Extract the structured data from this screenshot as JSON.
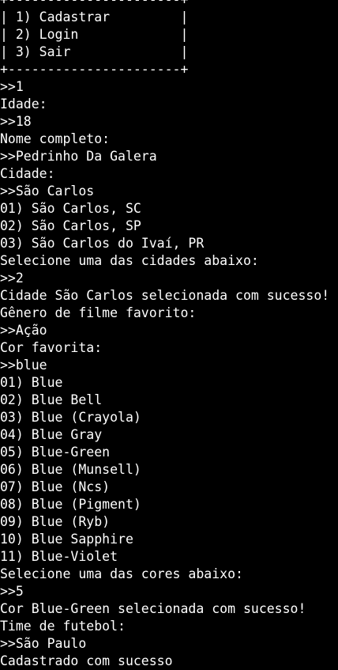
{
  "terminal": {
    "lines": [
      {
        "kind": "menu-border",
        "text": "+----------------------+"
      },
      {
        "kind": "menu-item",
        "text": "| 1) Cadastrar         |"
      },
      {
        "kind": "menu-item",
        "text": "| 2) Login             |"
      },
      {
        "kind": "menu-item",
        "text": "| 3) Sair              |"
      },
      {
        "kind": "menu-border",
        "text": "+----------------------+"
      },
      {
        "kind": "input",
        "text": ">>1"
      },
      {
        "kind": "prompt",
        "text": "Idade:"
      },
      {
        "kind": "input",
        "text": ">>18"
      },
      {
        "kind": "prompt",
        "text": "Nome completo:"
      },
      {
        "kind": "input",
        "text": ">>Pedrinho Da Galera"
      },
      {
        "kind": "prompt",
        "text": "Cidade:"
      },
      {
        "kind": "input",
        "text": ">>São Carlos"
      },
      {
        "kind": "option",
        "text": "01) São Carlos, SC"
      },
      {
        "kind": "option",
        "text": "02) São Carlos, SP"
      },
      {
        "kind": "option",
        "text": "03) São Carlos do Ivaí, PR"
      },
      {
        "kind": "prompt",
        "text": "Selecione uma das cidades abaixo:"
      },
      {
        "kind": "input",
        "text": ">>2"
      },
      {
        "kind": "message",
        "text": "Cidade São Carlos selecionada com sucesso!"
      },
      {
        "kind": "prompt",
        "text": "Gênero de filme favorito:"
      },
      {
        "kind": "input",
        "text": ">>Ação"
      },
      {
        "kind": "prompt",
        "text": "Cor favorita:"
      },
      {
        "kind": "input",
        "text": ">>blue"
      },
      {
        "kind": "option",
        "text": "01) Blue"
      },
      {
        "kind": "option",
        "text": "02) Blue Bell"
      },
      {
        "kind": "option",
        "text": "03) Blue (Crayola)"
      },
      {
        "kind": "option",
        "text": "04) Blue Gray"
      },
      {
        "kind": "option",
        "text": "05) Blue-Green"
      },
      {
        "kind": "option",
        "text": "06) Blue (Munsell)"
      },
      {
        "kind": "option",
        "text": "07) Blue (Ncs)"
      },
      {
        "kind": "option",
        "text": "08) Blue (Pigment)"
      },
      {
        "kind": "option",
        "text": "09) Blue (Ryb)"
      },
      {
        "kind": "option",
        "text": "10) Blue Sapphire"
      },
      {
        "kind": "option",
        "text": "11) Blue-Violet"
      },
      {
        "kind": "prompt",
        "text": "Selecione uma das cores abaixo:"
      },
      {
        "kind": "input",
        "text": ">>5"
      },
      {
        "kind": "message",
        "text": "Cor Blue-Green selecionada com sucesso!"
      },
      {
        "kind": "prompt",
        "text": "Time de futebol:"
      },
      {
        "kind": "input",
        "text": ">>São Paulo"
      },
      {
        "kind": "message",
        "text": "Cadastrado com sucesso"
      }
    ]
  },
  "colors": {
    "background": "#000000",
    "foreground": "#ffffff"
  }
}
